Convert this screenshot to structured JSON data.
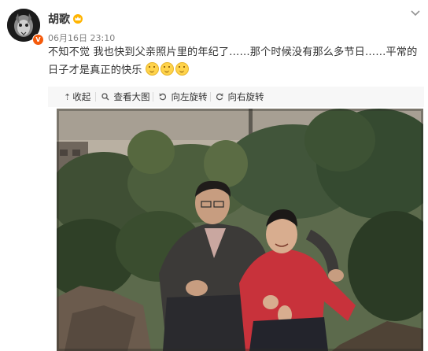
{
  "user": {
    "name": "胡歌",
    "timestamp": "06月16日 23:10"
  },
  "post": {
    "text": "不知不觉 我也快到父亲照片里的年纪了……那个时候没有那么多节日……平常的日子才是真正的快乐",
    "emoji_count": 3,
    "emoji_icon": "smile-emoji"
  },
  "toolbar": {
    "collapse": "收起",
    "view_large": "查看大图",
    "rotate_left": "向左旋转",
    "rotate_right": "向右旋转"
  },
  "colors": {
    "verified": "#f55a0b",
    "toolbar_bg": "#f7f7f7",
    "text": "#333333",
    "meta": "#808080"
  },
  "icons": {
    "collapse": "arrow-up-icon",
    "view_large": "search-icon",
    "rotate_left": "rotate-left-icon",
    "rotate_right": "rotate-right-icon",
    "more": "chevron-down-icon",
    "badge": "crown-icon"
  }
}
